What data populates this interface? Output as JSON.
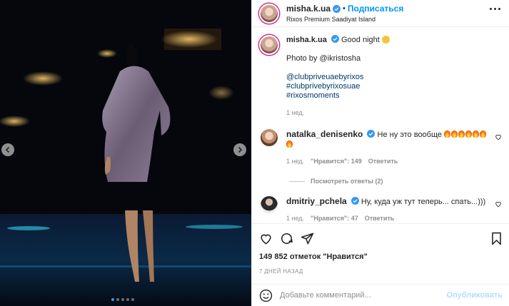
{
  "header": {
    "username": "misha.k.ua",
    "separator": "•",
    "follow_label": "Подписаться",
    "location": "Rixos Premium Saadiyat Island"
  },
  "caption": {
    "username": "misha.k.ua",
    "text": "Good night",
    "photo_by": "Photo by @ikristosha",
    "tags": [
      "@clubpriveuaebyrixos",
      "#clubprivebyrixosuae",
      "#rixosmoments"
    ],
    "time": "1 нед."
  },
  "comments": [
    {
      "username": "natalka_denisenko",
      "text": "Не ну это вообще",
      "fire_count": 7,
      "time": "1 нед.",
      "likes": "\"Нравится\": 149",
      "reply_label": "Ответить"
    },
    {
      "username": "dmitriy_pchela",
      "text": "Ну, куда уж тут теперь... спать...)))",
      "time": "1 нед.",
      "likes": "\"Нравится\": 47",
      "reply_label": "Ответить"
    }
  ],
  "view_replies": "Посмотреть ответы (2)",
  "likes_text": "149 852 отметок \"Нравится\"",
  "post_time": "7 ДНЕЙ НАЗАД",
  "add_comment": {
    "placeholder": "Добавьте комментарий...",
    "publish_label": "Опубликовать"
  },
  "carousel": {
    "slides": 5,
    "active_index": 0
  },
  "colors": {
    "accent": "#0095f6",
    "verified": "#3897f0",
    "muted": "#8e8e8e",
    "tag": "#00376b"
  },
  "icons": [
    "verified-icon",
    "more-icon",
    "heart-icon",
    "comment-icon",
    "share-icon",
    "bookmark-icon",
    "emoji-icon",
    "chevron-left-icon",
    "chevron-right-icon"
  ]
}
